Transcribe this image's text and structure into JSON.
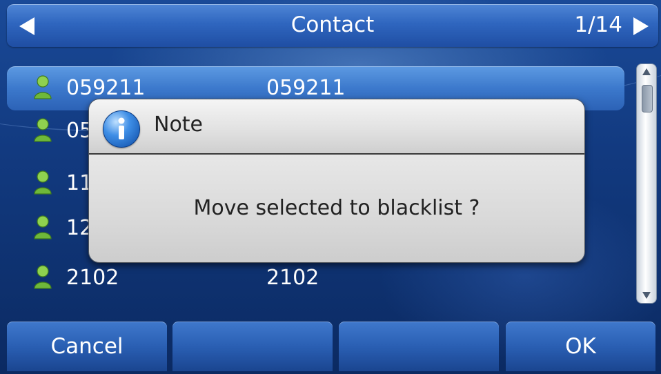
{
  "header": {
    "title": "Contact",
    "page_indicator": "1/14"
  },
  "contacts": [
    {
      "name": "059211",
      "number": "059211",
      "selected": true
    },
    {
      "name": "05",
      "number": ""
    },
    {
      "name": "11",
      "number": ""
    },
    {
      "name": "12",
      "number": ""
    },
    {
      "name": "2102",
      "number": "2102"
    }
  ],
  "dialog": {
    "title": "Note",
    "message": "Move selected to blacklist ?",
    "icon": "info-icon"
  },
  "softkeys": [
    {
      "label": "Cancel"
    },
    {
      "label": ""
    },
    {
      "label": ""
    },
    {
      "label": "OK"
    }
  ],
  "colors": {
    "title_bar": "#2f66bf",
    "selected_row": "#3c79cc",
    "contact_icon": "#7bc043",
    "dialog_bg": "#dcdcdc"
  }
}
